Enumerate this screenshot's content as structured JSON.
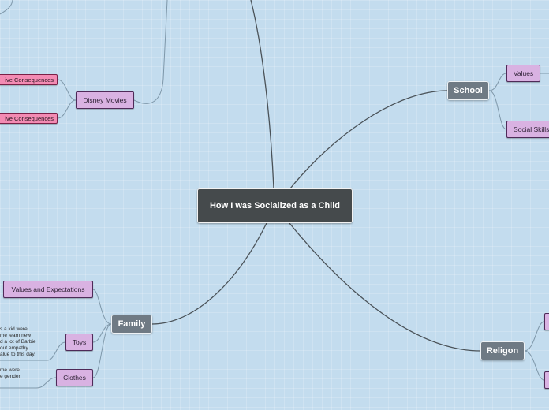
{
  "central": "How I was Socialized as a Child",
  "branches": {
    "school": "School",
    "family": "Family",
    "religion": "Religon"
  },
  "school_children": {
    "values": "Values",
    "social_skills": "Social Skills"
  },
  "family_children": {
    "values_expectations": "Values and Expectations",
    "toys": "Toys",
    "clothes": "Clothes"
  },
  "disney": {
    "label": "Disney Movies",
    "consequence_1": "ive Consequences",
    "consequence_2": "ive Consequences"
  },
  "toys_note": [
    "s a kid were",
    "me learn new",
    "d a lot of Barbie",
    "out empathy",
    "alue to this day."
  ],
  "clothes_note": [
    "me were",
    "e gender"
  ],
  "colors": {
    "background": "#c3dcee",
    "central": "#454a4c",
    "main_topic": "#6f7a84",
    "subtopic": "#d9b2e2",
    "consequence": "#f38bb3",
    "connector": "#4a5258"
  }
}
